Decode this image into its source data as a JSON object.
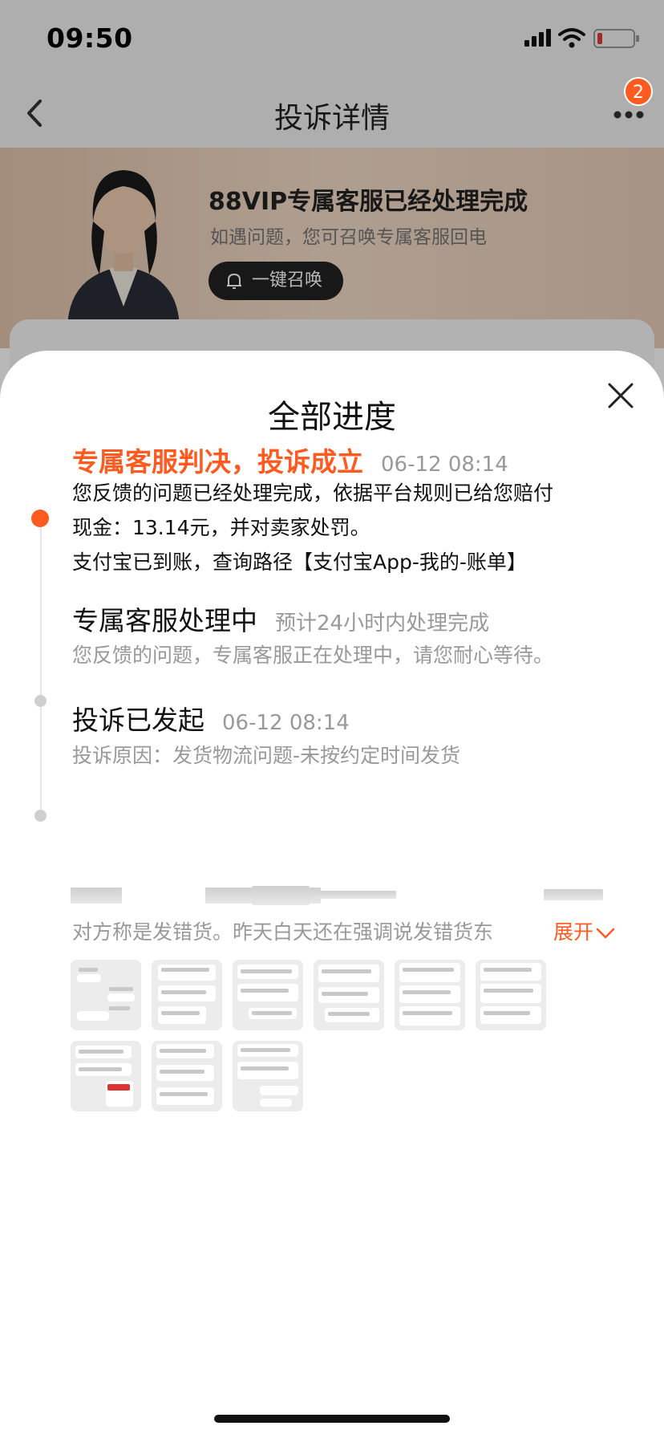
{
  "status_bar": {
    "time": "09:50"
  },
  "nav": {
    "title": "投诉详情",
    "badge_count": "2"
  },
  "hero": {
    "title": "88VIP专属客服已经处理完成",
    "subtitle": "如遇问题，您可召唤专属客服回电",
    "summon_button": "一键召唤"
  },
  "sheet": {
    "title": "全部进度",
    "steps": [
      {
        "title": "专属客服判决，投诉成立",
        "time": "06-12 08:14",
        "lines": [
          "您反馈的问题已经处理完成，依据平台规则已给您赔付",
          "现金：13.14元，并对卖家处罚。",
          "支付宝已到账，查询路径【支付宝App-我的-账单】"
        ]
      },
      {
        "title": "专属客服处理中",
        "note": "预计24小时内处理完成",
        "lines": [
          "您反馈的问题，专属客服正在处理中，请您耐心等待。"
        ]
      },
      {
        "title": "投诉已发起",
        "time": "06-12 08:14",
        "reason": "投诉原因：发货物流问题-未按约定时间发货",
        "description": "对方称是发错货。昨天白天还在强调说发错货东",
        "expand": "展开"
      }
    ],
    "thumbnail_count": 9
  },
  "colors": {
    "accent": "#ff5a1f",
    "muted": "#999999"
  }
}
